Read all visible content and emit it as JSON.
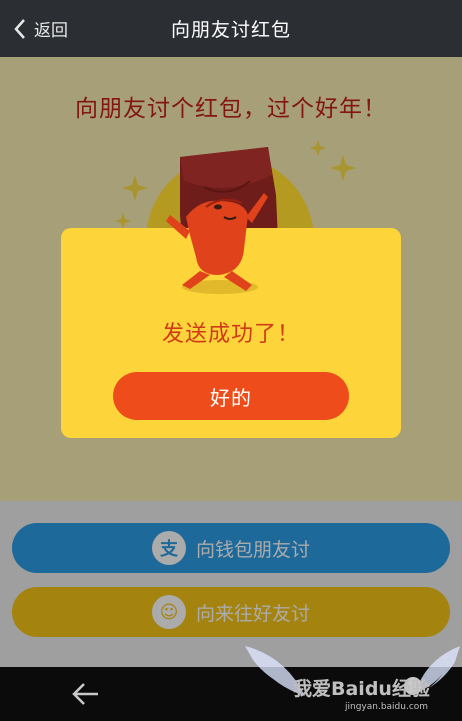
{
  "header": {
    "back_label": "返回",
    "title": "向朋友讨红包"
  },
  "content": {
    "headline": "向朋友讨个红包，过个好年！"
  },
  "actions": {
    "wallet_friends": "向钱包朋友讨",
    "contacts_friends": "向来往好友讨",
    "wallet_icon_glyph": "支",
    "contacts_icon_glyph": "☺"
  },
  "dialog": {
    "message": "发送成功了！",
    "ok_label": "好的"
  },
  "watermark": {
    "text": "我爱Baidu经验",
    "url": "jingyan.baidu.com"
  },
  "colors": {
    "header_bg": "#2b2f34",
    "headline_red": "#c3221b",
    "dialog_yellow": "#fdd53a",
    "ok_orange": "#ee4d1b",
    "pill_blue": "#2b9de6",
    "pill_yellow": "#f5c515"
  }
}
